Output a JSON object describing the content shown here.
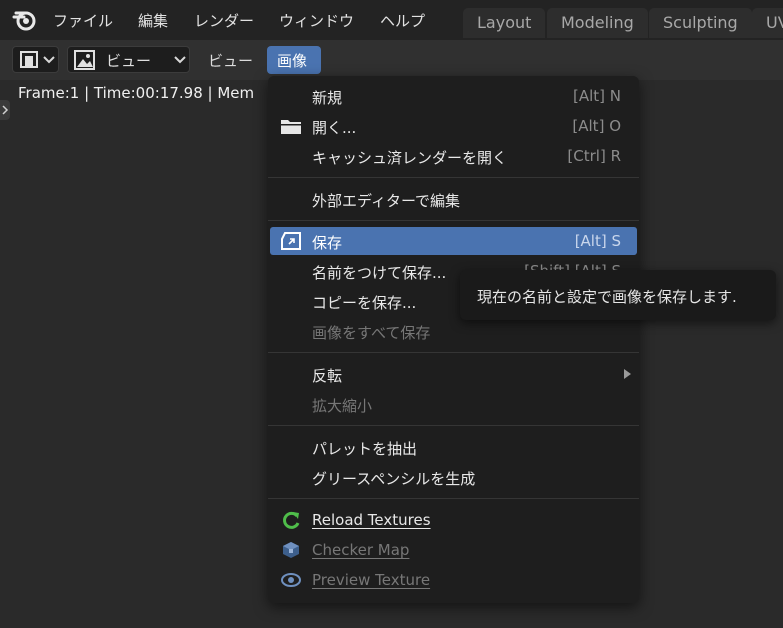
{
  "menubar": {
    "items": [
      "ファイル",
      "編集",
      "レンダー",
      "ウィンドウ",
      "ヘルプ"
    ]
  },
  "workspace_tabs": [
    "Layout",
    "Modeling",
    "Sculpting",
    "UV"
  ],
  "header": {
    "view_dropdown": "ビュー",
    "view_menu": "ビュー",
    "image_menu": "画像"
  },
  "viewport": {
    "stats": "Frame:1 | Time:00:17.98 | Mem"
  },
  "image_menu": {
    "items": [
      {
        "label": "新規",
        "shortcut": "[Alt] N"
      },
      {
        "label": "開く...",
        "shortcut": "[Alt] O",
        "icon": "folder-icon"
      },
      {
        "label": "キャッシュ済レンダーを開く",
        "shortcut": "[Ctrl] R"
      },
      {
        "label": "外部エディターで編集",
        "shortcut": ""
      },
      {
        "label": "保存",
        "shortcut": "[Alt] S",
        "icon": "save-icon",
        "highlighted": true
      },
      {
        "label": "名前をつけて保存...",
        "shortcut": "[Shift] [Alt] S"
      },
      {
        "label": "コピーを保存...",
        "shortcut": ""
      },
      {
        "label": "画像をすべて保存",
        "shortcut": "",
        "disabled": true
      },
      {
        "label": "反転",
        "shortcut": "",
        "submenu": true
      },
      {
        "label": "拡大縮小",
        "shortcut": "",
        "disabled": true
      },
      {
        "label": "パレットを抽出",
        "shortcut": ""
      },
      {
        "label": "グリースペンシルを生成",
        "shortcut": ""
      },
      {
        "label": "Reload Textures",
        "shortcut": "",
        "icon": "reload-icon"
      },
      {
        "label": "Checker Map",
        "shortcut": "",
        "icon": "checker-map-icon",
        "disabled": true
      },
      {
        "label": "Preview Texture",
        "shortcut": "",
        "icon": "preview-eye-icon",
        "disabled": true
      }
    ]
  },
  "tooltip": {
    "text": "現在の名前と設定で画像を保存します."
  },
  "colors": {
    "accent": "#4a73b0",
    "menu_bg": "#1e1e1e",
    "reload_green": "#4fbd4a"
  }
}
